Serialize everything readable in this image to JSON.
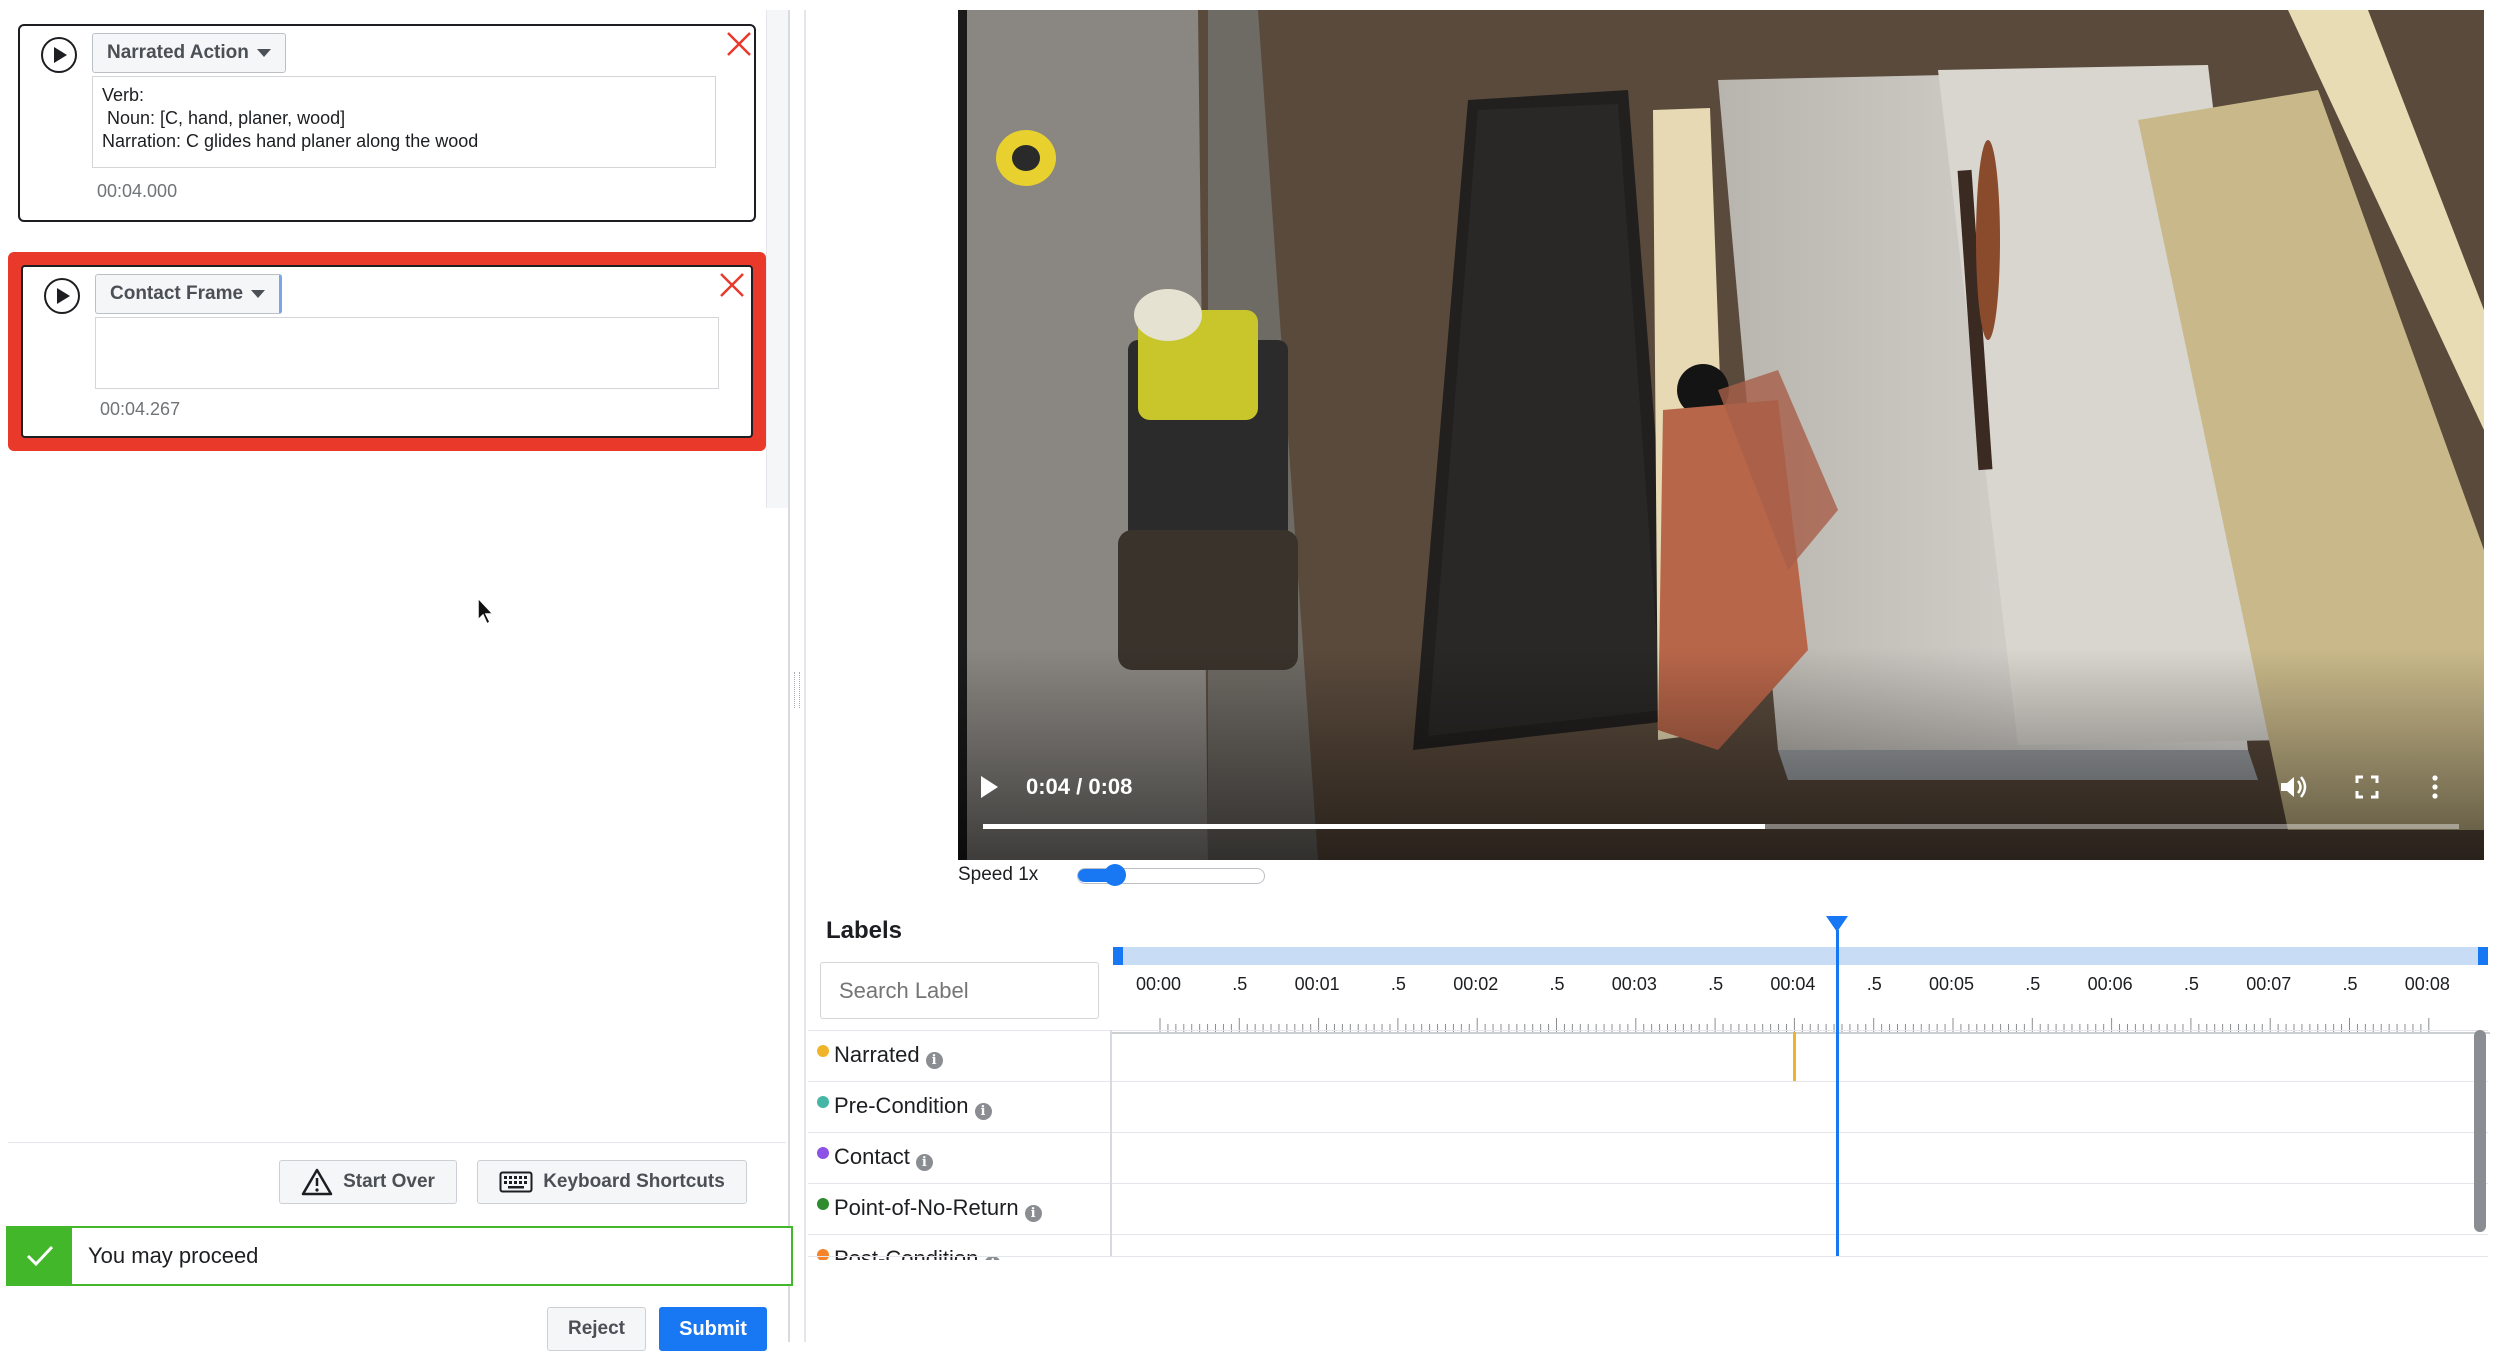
{
  "annotations": [
    {
      "type_label": "Narrated Action",
      "text": "Verb:\n Noun: [C, hand, planer, wood]\nNarration: C glides hand planer along the wood",
      "time": "00:04.000"
    },
    {
      "type_label": "Contact Frame",
      "text": "",
      "time": "00:04.267"
    }
  ],
  "footer": {
    "start_over_label": "Start Over",
    "keyboard_shortcuts_label": "Keyboard Shortcuts",
    "status_message": "You may proceed",
    "reject_label": "Reject",
    "submit_label": "Submit"
  },
  "video": {
    "time_display": "0:04 / 0:08",
    "progress": 0.53,
    "speed_label": "Speed 1x",
    "speed_value": 0.2
  },
  "labels_panel": {
    "title": "Labels",
    "search_placeholder": "Search Label",
    "ticks": [
      "00:00",
      ".5",
      "00:01",
      ".5",
      "00:02",
      ".5",
      "00:03",
      ".5",
      "00:04",
      ".5",
      "00:05",
      ".5",
      "00:06",
      ".5",
      "00:07",
      ".5",
      "00:08"
    ],
    "playhead_time": "00:04.267",
    "rows": [
      {
        "name": "Narrated",
        "color": "#f0b429",
        "marker_time": 4.0
      },
      {
        "name": "Pre-Condition",
        "color": "#45b5a6",
        "marker_time": null
      },
      {
        "name": "Contact",
        "color": "#8c52e5",
        "marker_time": 4.267
      },
      {
        "name": "Point-of-No-Return",
        "color": "#2e8b2e",
        "marker_time": null
      },
      {
        "name": "Post-Condition",
        "color": "#f5832a",
        "marker_time": null
      }
    ]
  },
  "colors": {
    "accent": "#1877f2",
    "highlight_border": "#e8392b",
    "success": "#42b72a",
    "timeline_bar": "#c9dcf5"
  }
}
